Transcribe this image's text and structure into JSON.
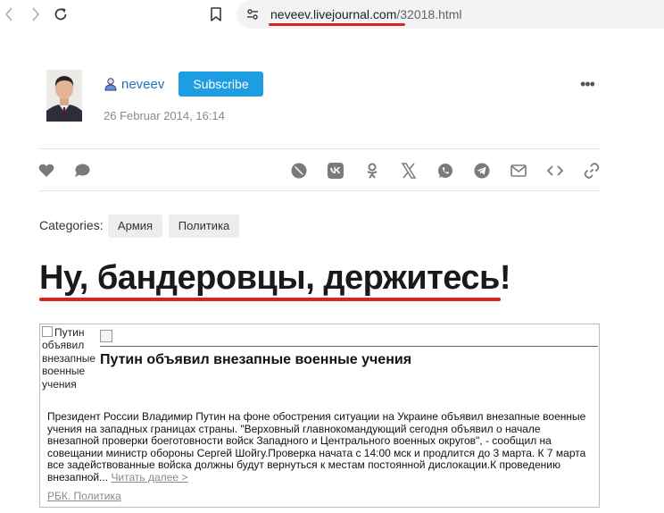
{
  "browser": {
    "url_host": "neveev.livejournal.com",
    "url_path": "/32018.html"
  },
  "author": {
    "name": "neveev",
    "subscribe_label": "Subscribe",
    "date": "26 Februar 2014, 16:14",
    "more_label": "•••"
  },
  "share_bar": {
    "icons": [
      "heart-icon",
      "comment-icon",
      "livejournal-icon",
      "vk-icon",
      "odnoklassniki-icon",
      "x-icon",
      "whatsapp-icon",
      "telegram-icon",
      "email-icon",
      "embed-icon",
      "link-icon"
    ]
  },
  "categories": {
    "label": "Categories:",
    "tags": [
      "Армия",
      "Политика"
    ]
  },
  "post": {
    "title": "Ну, бандеровцы, держитесь!"
  },
  "embed": {
    "image_alt": "Путин объявил внезапные военные учения",
    "headline": "Путин объявил внезапные военные учения",
    "body": "Президент России Владимир Путин на фоне обострения ситуации на Украине объявил внезапные военные учения на западных границах страны. \"Верховный главнокомандующий сегодня объявил о начале внезапной проверки боеготовности войск Западного и Центрального военных округов\", - сообщил на совещании министр обороны Сергей Шойгу.Проверка начата с 14:00 мск и продлится до 3 марта. К 7 марта все задействованные войска должны будут вернуться к местам постоянной дислокации.К проведению внезапной...",
    "read_more": "Читать далее >",
    "source": "РБК. Политика"
  },
  "colors": {
    "accent_blue": "#1f9de3",
    "link_blue": "#1d74c0",
    "highlight_red": "#d9231c"
  }
}
